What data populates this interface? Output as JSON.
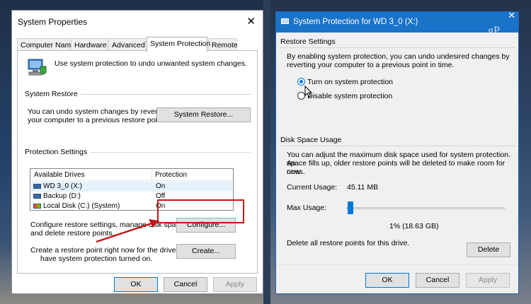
{
  "system_properties": {
    "title": "System Properties",
    "close": "✕",
    "tabs": [
      "Computer Name",
      "Hardware",
      "Advanced",
      "System Protection",
      "Remote"
    ],
    "active_tab": "System Protection",
    "description": "Use system protection to undo unwanted system changes.",
    "system_restore": {
      "label": "System Restore",
      "text_line1": "You can undo system changes by reverting",
      "text_line2": "your computer to a previous restore point.",
      "button": "System Restore..."
    },
    "protection_settings": {
      "label": "Protection Settings",
      "columns": [
        "Available Drives",
        "Protection"
      ],
      "drives": [
        {
          "name": "WD 3_0 (X:)",
          "protection": "On"
        },
        {
          "name": "Backup (D:)",
          "protection": "Off"
        },
        {
          "name": "Local Disk (C:) (System)",
          "protection": "On"
        }
      ],
      "configure_text1": "Configure restore settings, manage disk space,",
      "configure_text2": "and delete restore points.",
      "configure_button": "Configure...",
      "create_text1": "Create a restore point right now for the drives that",
      "create_text2": "have system protection turned on.",
      "create_button": "Create..."
    },
    "buttons": {
      "ok": "OK",
      "cancel": "Cancel",
      "apply": "Apply"
    }
  },
  "protection_dialog": {
    "title": "System Protection for WD 3_0 (X:)",
    "close": "✕",
    "watermark": "gP",
    "restore_settings": {
      "label": "Restore Settings",
      "text1": "By enabling system protection, you can undo undesired changes by",
      "text2": "reverting your computer to a previous point in time.",
      "option_on": "Turn on system protection",
      "option_off": "Disable system protection",
      "selected": "on"
    },
    "disk_space": {
      "label": "Disk Space Usage",
      "text1": "You can adjust the maximum disk space used for system protection. As",
      "text2": "space fills up, older restore points will be deleted to make room for new",
      "text3": "ones.",
      "current_label": "Current Usage:",
      "current_value": "45.11 MB",
      "max_label": "Max Usage:",
      "max_value": "1% (18.63 GB)",
      "max_fraction": 0.01
    },
    "delete_text": "Delete all restore points for this drive.",
    "delete_button": "Delete",
    "buttons": {
      "ok": "OK",
      "cancel": "Cancel",
      "apply": "Apply"
    }
  }
}
